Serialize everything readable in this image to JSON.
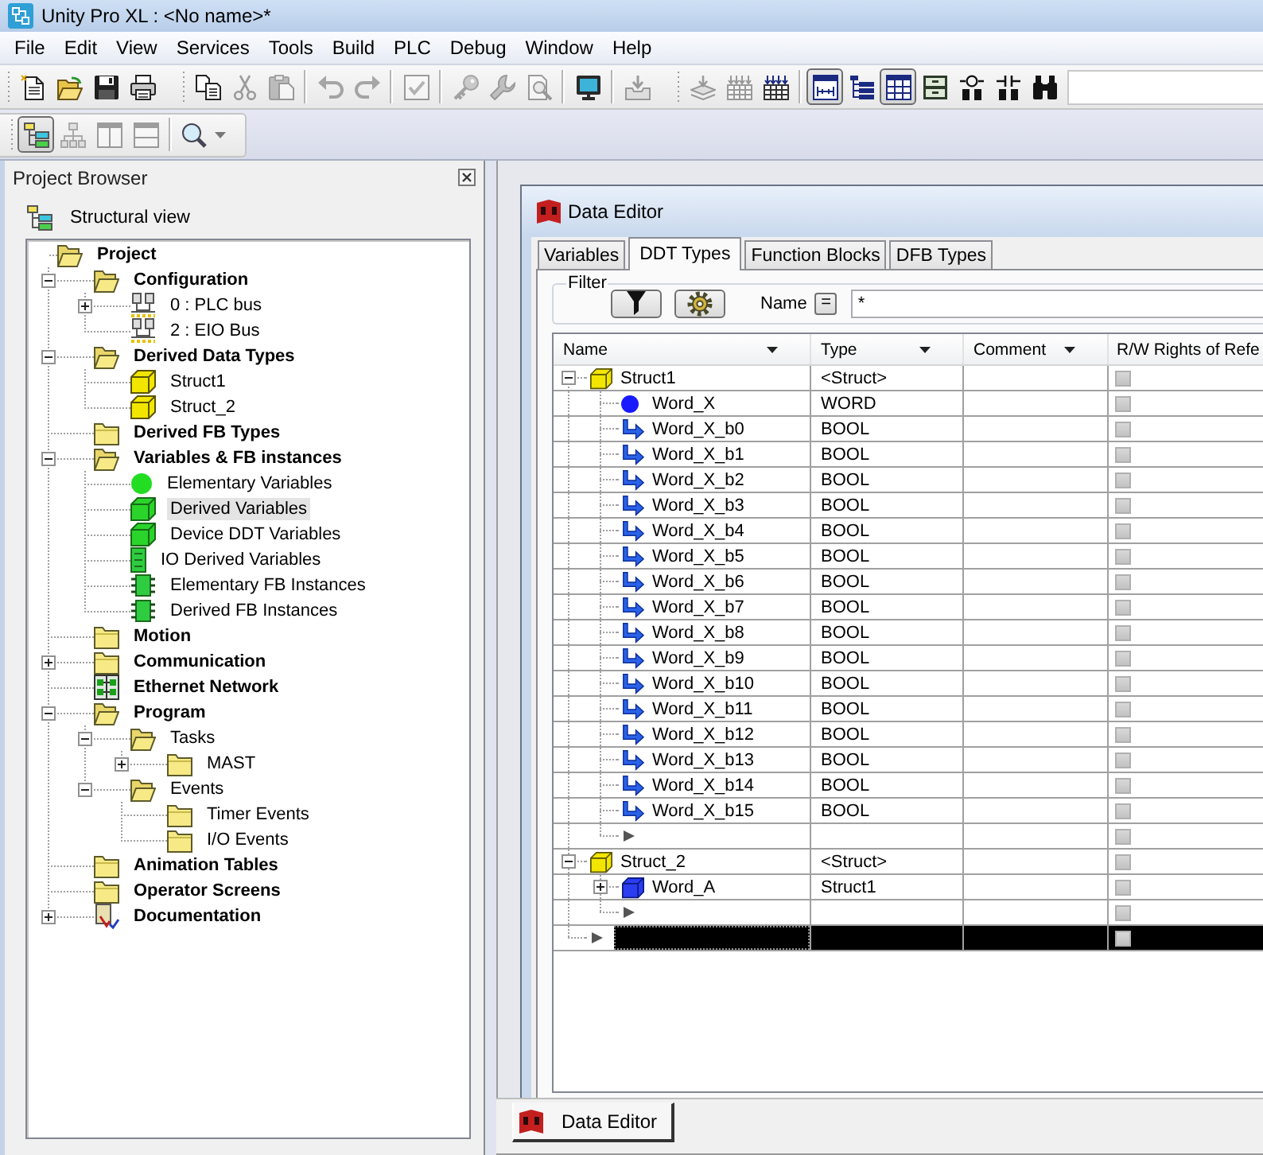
{
  "window": {
    "title": "Unity Pro XL : <No name>*"
  },
  "menu": [
    "File",
    "Edit",
    "View",
    "Services",
    "Tools",
    "Build",
    "PLC",
    "Debug",
    "Window",
    "Help"
  ],
  "toolbar": {
    "bands": [
      [
        [
          {
            "kind": "new",
            "disabled": false,
            "pressed": false
          },
          {
            "kind": "open",
            "disabled": false,
            "pressed": false
          },
          {
            "kind": "save",
            "disabled": false,
            "pressed": false
          },
          {
            "kind": "print",
            "disabled": false,
            "pressed": false
          }
        ]
      ],
      [
        [
          {
            "kind": "copy",
            "disabled": false,
            "pressed": false
          },
          {
            "kind": "cut",
            "disabled": true,
            "pressed": false
          },
          {
            "kind": "paste",
            "disabled": true,
            "pressed": false
          }
        ],
        [
          {
            "kind": "undo",
            "disabled": true,
            "pressed": false
          },
          {
            "kind": "redo",
            "disabled": true,
            "pressed": false
          }
        ],
        [
          {
            "kind": "check",
            "disabled": true,
            "pressed": false
          }
        ],
        [
          {
            "kind": "key",
            "disabled": true,
            "pressed": false
          },
          {
            "kind": "wrench",
            "disabled": true,
            "pressed": false
          },
          {
            "kind": "find",
            "disabled": true,
            "pressed": false
          }
        ],
        [
          {
            "kind": "monitor",
            "disabled": false,
            "pressed": false
          }
        ],
        [
          {
            "kind": "tray",
            "disabled": true,
            "pressed": false
          }
        ]
      ],
      [
        [
          {
            "kind": "layers",
            "disabled": true,
            "pressed": false
          },
          {
            "kind": "grid",
            "disabled": true,
            "pressed": false
          },
          {
            "kind": "grid",
            "disabled": false,
            "pressed": false
          }
        ],
        [
          {
            "kind": "window",
            "disabled": false,
            "pressed": true
          },
          {
            "kind": "list",
            "disabled": false,
            "pressed": false
          },
          {
            "kind": "table",
            "disabled": false,
            "pressed": true
          },
          {
            "kind": "drawer",
            "disabled": false,
            "pressed": false
          },
          {
            "kind": "coil",
            "disabled": false,
            "pressed": false
          },
          {
            "kind": "contact",
            "disabled": false,
            "pressed": false
          },
          {
            "kind": "binoculars",
            "disabled": false,
            "pressed": false
          }
        ]
      ]
    ]
  },
  "toolbar_2": {
    "bands": [
      [
        [
          {
            "kind": "tree",
            "disabled": false,
            "pressed": true
          },
          {
            "kind": "hierarchy",
            "disabled": true,
            "pressed": false
          },
          {
            "kind": "columns",
            "disabled": true,
            "pressed": false
          },
          {
            "kind": "rows",
            "disabled": true,
            "pressed": false
          }
        ],
        [
          {
            "kind": "zoom",
            "disabled": false,
            "pressed": false
          }
        ]
      ]
    ]
  },
  "project_browser": {
    "title": "Project Browser",
    "view": "Structural view",
    "tree": [
      {
        "label": "Project",
        "kind": "folder",
        "expanded": true,
        "selected": false,
        "children": [
          {
            "label": "Configuration",
            "kind": "folder",
            "expanded": true,
            "selected": false,
            "children": [
              {
                "label": "0 : PLC bus",
                "kind": "bus",
                "expanded": false,
                "selected": false
              },
              {
                "label": "2 : EIO Bus",
                "kind": "bus",
                "selected": false
              }
            ]
          },
          {
            "label": "Derived Data Types",
            "kind": "folder",
            "expanded": true,
            "selected": false,
            "children": [
              {
                "label": "Struct1",
                "kind": "struct",
                "selected": false
              },
              {
                "label": "Struct_2",
                "kind": "struct",
                "selected": false
              }
            ]
          },
          {
            "label": "Derived FB Types",
            "kind": "folder",
            "selected": false
          },
          {
            "label": "Variables & FB instances",
            "kind": "folder",
            "expanded": true,
            "selected": false,
            "children": [
              {
                "label": "Elementary Variables",
                "kind": "variable",
                "selected": false
              },
              {
                "label": "Derived Variables",
                "kind": "derived-variable",
                "selected": true
              },
              {
                "label": "Device DDT Variables",
                "kind": "derived-variable",
                "selected": false
              },
              {
                "label": "IO Derived Variables",
                "kind": "io-variable",
                "selected": false
              },
              {
                "label": "Elementary FB Instances",
                "kind": "fb-instance",
                "selected": false
              },
              {
                "label": "Derived FB Instances",
                "kind": "fb-instance",
                "selected": false
              }
            ]
          },
          {
            "label": "Motion",
            "kind": "folder",
            "selected": false
          },
          {
            "label": "Communication",
            "kind": "folder",
            "expanded": false,
            "selected": false
          },
          {
            "label": "Ethernet Network",
            "kind": "network",
            "selected": false
          },
          {
            "label": "Program",
            "kind": "folder",
            "expanded": true,
            "selected": false,
            "children": [
              {
                "label": "Tasks",
                "kind": "folder",
                "expanded": true,
                "selected": false,
                "children": [
                  {
                    "label": "MAST",
                    "kind": "folder",
                    "expanded": false,
                    "selected": false
                  }
                ]
              },
              {
                "label": "Events",
                "kind": "folder",
                "expanded": true,
                "selected": false,
                "children": [
                  {
                    "label": "Timer Events",
                    "kind": "folder",
                    "selected": false
                  },
                  {
                    "label": "I/O Events",
                    "kind": "folder",
                    "selected": false
                  }
                ]
              }
            ]
          },
          {
            "label": "Animation Tables",
            "kind": "folder",
            "selected": false
          },
          {
            "label": "Operator Screens",
            "kind": "folder",
            "selected": false
          },
          {
            "label": "Documentation",
            "kind": "document",
            "expanded": false,
            "selected": false
          }
        ]
      }
    ]
  },
  "data_editor": {
    "title": "Data Editor",
    "tabs": [
      {
        "label": "Variables",
        "selected": false
      },
      {
        "label": "DDT Types",
        "selected": true
      },
      {
        "label": "Function Blocks",
        "selected": false
      },
      {
        "label": "DFB Types",
        "selected": false
      }
    ],
    "filter": {
      "label": "Filter",
      "name_label": "Name",
      "operator": "=",
      "value": "*"
    },
    "columns": [
      {
        "label": "Name",
        "dropdown": true
      },
      {
        "label": "Type",
        "dropdown": true
      },
      {
        "label": "Comment",
        "dropdown": true
      },
      {
        "label": "R/W Rights of Refe",
        "dropdown": false
      }
    ],
    "rows": [
      {
        "name": "Struct1",
        "type": "<Struct>",
        "kind": "struct",
        "expanded": true,
        "selected": false,
        "rw_checked": false,
        "children": [
          {
            "name": "Word_X",
            "type": "WORD",
            "kind": "word",
            "selected": false,
            "rw_checked": false
          },
          {
            "name": "Word_X_b0",
            "type": "BOOL",
            "kind": "bit",
            "selected": false,
            "rw_checked": false
          },
          {
            "name": "Word_X_b1",
            "type": "BOOL",
            "kind": "bit",
            "selected": false,
            "rw_checked": false
          },
          {
            "name": "Word_X_b2",
            "type": "BOOL",
            "kind": "bit",
            "selected": false,
            "rw_checked": false
          },
          {
            "name": "Word_X_b3",
            "type": "BOOL",
            "kind": "bit",
            "selected": false,
            "rw_checked": false
          },
          {
            "name": "Word_X_b4",
            "type": "BOOL",
            "kind": "bit",
            "selected": false,
            "rw_checked": false
          },
          {
            "name": "Word_X_b5",
            "type": "BOOL",
            "kind": "bit",
            "selected": false,
            "rw_checked": false
          },
          {
            "name": "Word_X_b6",
            "type": "BOOL",
            "kind": "bit",
            "selected": false,
            "rw_checked": false
          },
          {
            "name": "Word_X_b7",
            "type": "BOOL",
            "kind": "bit",
            "selected": false,
            "rw_checked": false
          },
          {
            "name": "Word_X_b8",
            "type": "BOOL",
            "kind": "bit",
            "selected": false,
            "rw_checked": false
          },
          {
            "name": "Word_X_b9",
            "type": "BOOL",
            "kind": "bit",
            "selected": false,
            "rw_checked": false
          },
          {
            "name": "Word_X_b10",
            "type": "BOOL",
            "kind": "bit",
            "selected": false,
            "rw_checked": false
          },
          {
            "name": "Word_X_b11",
            "type": "BOOL",
            "kind": "bit",
            "selected": false,
            "rw_checked": false
          },
          {
            "name": "Word_X_b12",
            "type": "BOOL",
            "kind": "bit",
            "selected": false,
            "rw_checked": false
          },
          {
            "name": "Word_X_b13",
            "type": "BOOL",
            "kind": "bit",
            "selected": false,
            "rw_checked": false
          },
          {
            "name": "Word_X_b14",
            "type": "BOOL",
            "kind": "bit",
            "selected": false,
            "rw_checked": false
          },
          {
            "name": "Word_X_b15",
            "type": "BOOL",
            "kind": "bit",
            "selected": false,
            "rw_checked": false
          },
          {
            "kind": "new",
            "selected": false,
            "rw_checked": false
          }
        ]
      },
      {
        "name": "Struct_2",
        "type": "<Struct>",
        "kind": "struct",
        "expanded": true,
        "selected": false,
        "rw_checked": false,
        "children": [
          {
            "name": "Word_A",
            "type": "Struct1",
            "kind": "instance",
            "expanded": false,
            "selected": false,
            "rw_checked": false
          },
          {
            "kind": "new",
            "selected": false,
            "rw_checked": false
          }
        ]
      },
      {
        "kind": "new",
        "selected": true,
        "rw_checked": false
      }
    ]
  },
  "bottom_tabs": [
    {
      "label": "Data Editor",
      "selected": true
    }
  ]
}
